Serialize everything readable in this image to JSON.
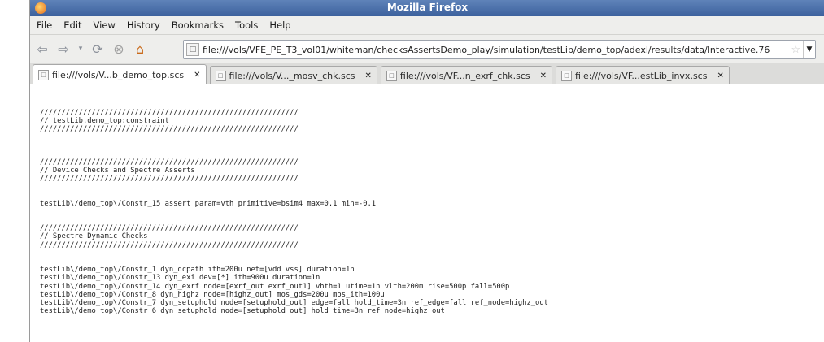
{
  "window": {
    "title": "Mozilla Firefox"
  },
  "menu": [
    "File",
    "Edit",
    "View",
    "History",
    "Bookmarks",
    "Tools",
    "Help"
  ],
  "nav": {
    "url": "file:///vols/VFE_PE_T3_vol01/whiteman/checksAssertsDemo_play/simulation/testLib/demo_top/adexl/results/data/Interactive.76"
  },
  "tabs": [
    {
      "label": "file:///vols/V...b_demo_top.scs",
      "active": true
    },
    {
      "label": "file:///vols/V..._mosv_chk.scs",
      "active": false
    },
    {
      "label": "file:///vols/VF...n_exrf_chk.scs",
      "active": false
    },
    {
      "label": "file:///vols/VF...estLib_invx.scs",
      "active": false
    }
  ],
  "content": {
    "lines": [
      "",
      "",
      "",
      "////////////////////////////////////////////////////////////",
      "// testLib.demo_top:constraint",
      "////////////////////////////////////////////////////////////",
      "",
      "",
      "",
      "////////////////////////////////////////////////////////////",
      "// Device Checks and Spectre Asserts",
      "////////////////////////////////////////////////////////////",
      "",
      "",
      "testLib\\/demo_top\\/Constr_15 assert param=vth primitive=bsim4 max=0.1 min=-0.1",
      "",
      "",
      "////////////////////////////////////////////////////////////",
      "// Spectre Dynamic Checks",
      "////////////////////////////////////////////////////////////",
      "",
      "",
      "testLib\\/demo_top\\/Constr_1 dyn_dcpath ith=200u net=[vdd vss] duration=1n",
      "testLib\\/demo_top\\/Constr_13 dyn_exi dev=[*] ith=900u duration=1n",
      "testLib\\/demo_top\\/Constr_14 dyn_exrf node=[exrf_out exrf_out1] vhth=1 utime=1n vlth=200m rise=500p fall=500p",
      "testLib\\/demo_top\\/Constr_8 dyn_highz node=[highz_out] mos_gds=200u mos_ith=100u",
      "testLib\\/demo_top\\/Constr_7 dyn_setuphold node=[setuphold_out] edge=fall hold_time=3n ref_edge=fall ref_node=highz_out",
      "testLib\\/demo_top\\/Constr_6 dyn_setuphold node=[setuphold_out] hold_time=3n ref_node=highz_out"
    ]
  }
}
